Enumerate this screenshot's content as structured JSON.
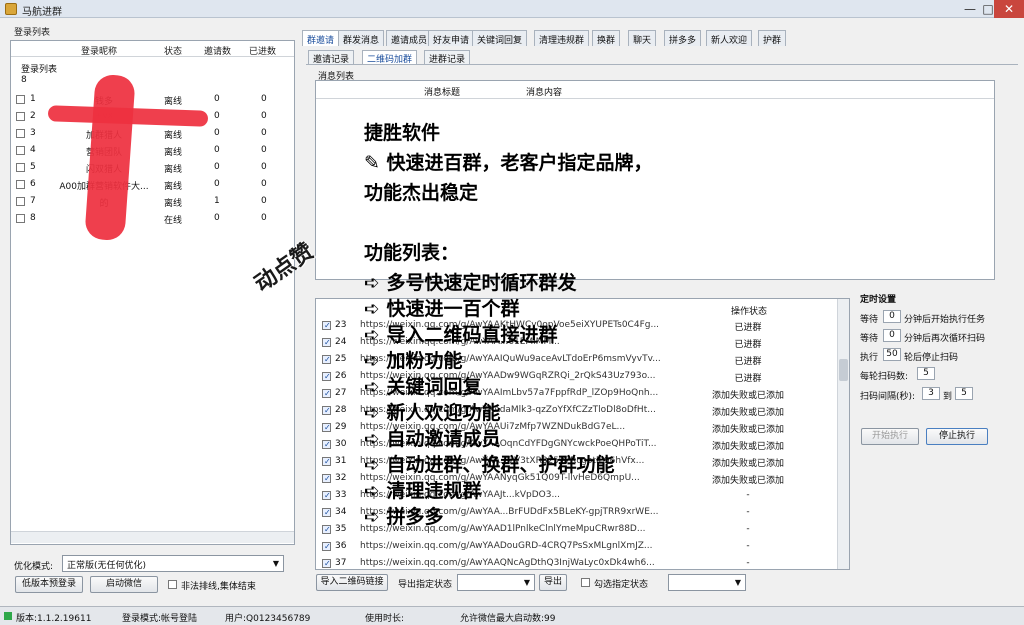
{
  "window": {
    "title": "马航进群",
    "minimize": "—",
    "maximize": "□",
    "close": "✕"
  },
  "left": {
    "group_title": "登录列表",
    "columns": [
      "登录昵称",
      "状态",
      "邀请数",
      "已进数"
    ],
    "sub_label": "登录列表",
    "count": "8",
    "rows": [
      {
        "no": "1",
        "name": "钱多",
        "status": "离线",
        "invites": "0",
        "joined": "0",
        "checked": false
      },
      {
        "no": "2",
        "name": "+vx",
        "status": "",
        "invites": "0",
        "joined": "0",
        "checked": false
      },
      {
        "no": "3",
        "name": "加群猎人",
        "status": "离线",
        "invites": "0",
        "joined": "0",
        "checked": false
      },
      {
        "no": "4",
        "name": "营销团队",
        "status": "离线",
        "invites": "0",
        "joined": "0",
        "checked": false
      },
      {
        "no": "5",
        "name": "闪双猎人",
        "status": "离线",
        "invites": "0",
        "joined": "0",
        "checked": false
      },
      {
        "no": "6",
        "name": "A00加群营销软件大...",
        "status": "离线",
        "invites": "0",
        "joined": "0",
        "checked": false
      },
      {
        "no": "7",
        "name": "的",
        "status": "离线",
        "invites": "1",
        "joined": "0",
        "checked": false
      },
      {
        "no": "8",
        "name": "",
        "status": "在线",
        "invites": "0",
        "joined": "0",
        "checked": false
      }
    ],
    "mode_label": "优化模式:",
    "mode_value": "正常版(无任何优化)",
    "btn_low": "低版本预登录",
    "btn_start_wechat": "启动微信",
    "chk_nonqueue": "非法排线,集体结束"
  },
  "tabs": [
    "群邀请",
    "群发消息",
    "邀请成员",
    "好友申请",
    "关键词回复",
    "清理违规群",
    "换群",
    "聊天",
    "拼多多",
    "新人欢迎",
    "护群"
  ],
  "subtabs": [
    "邀请记录",
    "二维码加群",
    "进群记录"
  ],
  "msg": {
    "group": "消息列表",
    "col_title": "消息标题",
    "col_content": "消息内容"
  },
  "invites": {
    "col_status": "操作状态",
    "rows": [
      {
        "no": "23",
        "url": "https://weixin.qq.com/g/AwYAAKtHWCy0opVoe5eiXYUPETs0C4Fg...",
        "status": "已进群"
      },
      {
        "no": "24",
        "url": "https://weixin.qq.com/g/AwYAA...61EMiMM...",
        "status": "已进群"
      },
      {
        "no": "25",
        "url": "https://weixin.qq.com/g/AwYAAIQuWu9aceAvLTdoErP6msmVyvTv...",
        "status": "已进群"
      },
      {
        "no": "26",
        "url": "https://weixin.qq.com/g/AwYAADw9WGqRZRQi_2rQkS43Uz793o...",
        "status": "已进群"
      },
      {
        "no": "27",
        "url": "https://weixin.qq.com/g/AwYAAImLbv57a7FppfRdP_lZOp9HoQnh...",
        "status": "添加失败或已添加"
      },
      {
        "no": "28",
        "url": "https://weixin.qq.com/g/AwYAAdaMlk3-qzZoYfXfCZzTloDl8oDfHt...",
        "status": "添加失败或已添加"
      },
      {
        "no": "29",
        "url": "https://weixin.qq.com/g/AwYAAUi7zMfp7WZNDukBdG7eL...",
        "status": "添加失败或已添加"
      },
      {
        "no": "30",
        "url": "https://weixin.qq.com/g/AwYAAOqnCdYFDgGNYcwckPoeQHPoTiT...",
        "status": "添加失败或已添加"
      },
      {
        "no": "31",
        "url": "https://weixin.qq.com/g/AwYAA...7V3tXR325v7RcgotlP96hVfx...",
        "status": "添加失败或已添加"
      },
      {
        "no": "32",
        "url": "https://weixin.qq.com/g/AwYAANyqGk51Q09T-llvHeD6QmpU...",
        "status": "添加失败或已添加"
      },
      {
        "no": "33",
        "url": "https://weixin.qq.com/g/AwYAAJt...kVpDO3...",
        "status": "-"
      },
      {
        "no": "34",
        "url": "https://weixin.qq.com/g/AwYAA...BrFUDdFx5BLeKY-gpjTRR9xrWE...",
        "status": "-"
      },
      {
        "no": "35",
        "url": "https://weixin.qq.com/g/AwYAAD1lPnlkeClnlYmeMpuCRwr88D...",
        "status": "-"
      },
      {
        "no": "36",
        "url": "https://weixin.qq.com/g/AwYAADouGRD-4CRQ7PsSxMLgnlXmJZ...",
        "status": "-"
      },
      {
        "no": "37",
        "url": "https://weixin.qq.com/g/AwYAAQNcAgDthQ3InjWaLyc0xDk4wh6...",
        "status": "-"
      }
    ],
    "btn_import": "导入二维码链接",
    "export_label": "导出指定状态",
    "btn_export": "导出",
    "chk_select_label": "勾选指定状态"
  },
  "timer": {
    "title": "定时设置",
    "wait1_pre": "等待",
    "wait1_val": "0",
    "wait1_post": "分钟后开始执行任务",
    "wait2_pre": "等待",
    "wait2_val": "0",
    "wait2_post": "分钟后再次循环扫码",
    "exec_pre": "执行",
    "exec_val": "50",
    "exec_post": "轮后停止扫码",
    "per_round_label": "每轮扫码数:",
    "per_round_val": "5",
    "interval_label": "扫码间隔(秒):",
    "interval_from": "3",
    "interval_to_label": "到",
    "interval_to": "5",
    "btn_start": "开始执行",
    "btn_stop": "停止执行"
  },
  "status": {
    "version": "版本:1.1.2.19611",
    "login_mode": "登录模式:帐号登陆",
    "user": "用户:Q0123456789",
    "usage": "使用时长:",
    "max_wechat": "允许微信最大启动数:99"
  },
  "overlay": {
    "l1": "捷胜软件",
    "l2": "✎ 快速进百群，老客户指定品牌，",
    "l3": "功能杰出稳定",
    "l4": "功能列表：",
    "features": [
      "➪ 多号快速定时循环群发",
      "➪ 快速进一百个群",
      "➪ 导入二维码直接进群",
      "➪ 加粉功能",
      "➪ 关键词回复",
      "➪ 新人欢迎功能",
      "➪ 自动邀请成员",
      "➪ 自动进群、换群、护群功能",
      "➪ 清理违规群",
      "➪ 拼多多"
    ],
    "sticker": "动点赞"
  }
}
